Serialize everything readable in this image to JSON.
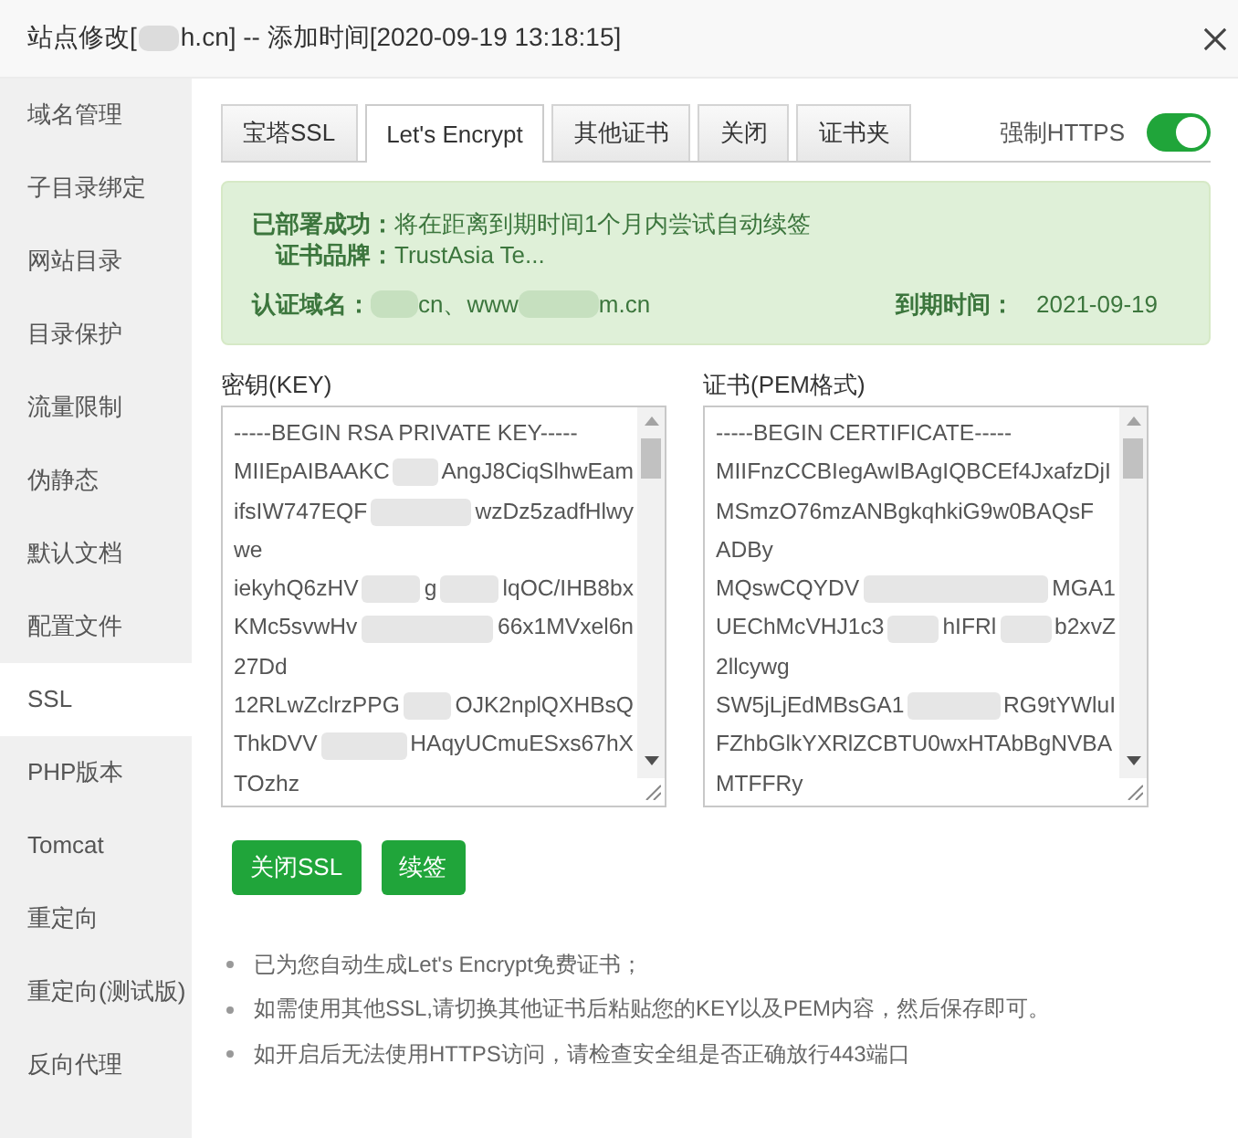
{
  "window": {
    "title_parts": [
      {
        "kind": "text",
        "text": "站点修改["
      },
      {
        "kind": "redacted"
      },
      {
        "kind": "text",
        "text": "h.cn] -- 添加时间[2020-09-19 13:18:15]"
      }
    ]
  },
  "sidebar": {
    "items": [
      {
        "label": "域名管理",
        "selected": false
      },
      {
        "label": "子目录绑定",
        "selected": false
      },
      {
        "label": "网站目录",
        "selected": false
      },
      {
        "label": "目录保护",
        "selected": false
      },
      {
        "label": "流量限制",
        "selected": false
      },
      {
        "label": "伪静态",
        "selected": false
      },
      {
        "label": "默认文档",
        "selected": false
      },
      {
        "label": "配置文件",
        "selected": false
      },
      {
        "label": "SSL",
        "selected": true
      },
      {
        "label": "PHP版本",
        "selected": false
      },
      {
        "label": "Tomcat",
        "selected": false
      },
      {
        "label": "重定向",
        "selected": false
      },
      {
        "label": "重定向(测试版)",
        "selected": false
      },
      {
        "label": "反向代理",
        "selected": false
      }
    ]
  },
  "tabs": [
    {
      "label": "宝塔SSL",
      "selected": false
    },
    {
      "label": "Let's Encrypt",
      "selected": true
    },
    {
      "label": "其他证书",
      "selected": false
    },
    {
      "label": "关闭",
      "selected": false
    },
    {
      "label": "证书夹",
      "selected": false
    }
  ],
  "force_https": {
    "label": "强制HTTPS",
    "on": true
  },
  "certificate_status": {
    "deployed": {
      "label": "已部署成功：",
      "value": "将在距离到期时间1个月内尝试自动续签"
    },
    "brand": {
      "label": "证书品牌：",
      "value": "TrustAsia Te..."
    },
    "domains": {
      "label": "认证域名：",
      "parts": [
        {
          "kind": "redacted"
        },
        {
          "kind": "text",
          "text": "cn、www"
        },
        {
          "kind": "redacted"
        },
        {
          "kind": "text",
          "text": "m.cn"
        }
      ]
    },
    "expiry": {
      "label": "到期时间：",
      "value": "2021-09-19"
    }
  },
  "key_field": {
    "label": "密钥(KEY)",
    "lines": [
      [
        "-----BEGIN RSA PRIVATE KEY-----"
      ],
      [
        "MIIEpAIBAAKC",
        "AngJ8CiqSlhwEam"
      ],
      [
        "ifsIW747EQF",
        "wzDz5zadfHlwy"
      ],
      [
        "we"
      ],
      [
        "iekyhQ6zHV",
        "g",
        "lqOC/IHB8bx"
      ],
      [
        "KMc5svwHv",
        "66x1MVxel6n"
      ],
      [
        "27Dd"
      ],
      [
        "12RLwZclrzPPG",
        "OJK2nplQXHBsQ"
      ],
      [
        "ThkDVV",
        "HAqyUCmuESxs67hX"
      ],
      [
        "TOzhz"
      ]
    ]
  },
  "certificate_field": {
    "label": "证书(PEM格式)",
    "lines": [
      [
        "-----BEGIN CERTIFICATE-----"
      ],
      [
        "MIIFnzCCBIegAwIBAgIQBCEf4JxafzDjI"
      ],
      [
        "MSmzO76mzANBgkqhkiG9w0BAQsF"
      ],
      [
        "ADBy"
      ],
      [
        "MQswCQYDV",
        "MGA1"
      ],
      [
        "UEChMcVHJ1c3",
        "hIFRl",
        "b2xvZ"
      ],
      [
        "2llcywg"
      ],
      [
        "SW5jLjEdMBsGA1",
        "RG9tYWluI"
      ],
      [
        "FZhbGlkYXRlZCBTU0wxHTAbBgNVBA"
      ],
      [
        "MTFFRy"
      ]
    ]
  },
  "buttons": [
    "关闭SSL",
    "续签"
  ],
  "notes": [
    "已为您自动生成Let's Encrypt免费证书；",
    "如需使用其他SSL,请切换其他证书后粘贴您的KEY以及PEM内容，然后保存即可。",
    "如开启后无法使用HTTPS访问，请检查安全组是否正确放行443端口"
  ]
}
